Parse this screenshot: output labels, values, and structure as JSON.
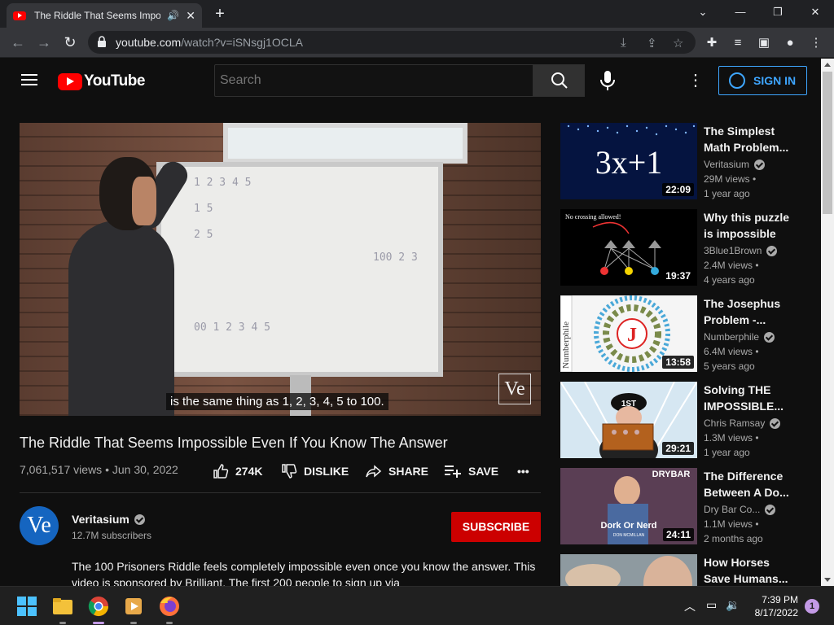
{
  "browser": {
    "tab_title": "The Riddle That Seems Impo",
    "tab_close": "✕",
    "new_tab": "+",
    "url_host": "youtube.com",
    "url_path": "/watch?v=iSNsgj1OCLA",
    "window_controls": [
      "⌄",
      "—",
      "❐",
      "✕"
    ]
  },
  "header": {
    "logo_text": "YouTube",
    "search_placeholder": "Search",
    "sign_in": "SIGN IN"
  },
  "video": {
    "caption": "is the same thing as 1, 2, 3, 4, 5 to 100.",
    "watermark": "Ve",
    "board_lines": [
      "1 2 3 4 5",
      "1 5",
      "2 5",
      "100 2 3",
      "00 1 2 3 4 5"
    ],
    "title": "The Riddle That Seems Impossible Even If You Know The Answer",
    "views": "7,061,517 views",
    "date": "Jun 30, 2022",
    "likes": "274K",
    "dislike": "DISLIKE",
    "share": "SHARE",
    "save": "SAVE",
    "more": "•••"
  },
  "channel": {
    "avatar_text": "Ve",
    "name": "Veritasium",
    "subscribers": "12.7M subscribers",
    "subscribe": "SUBSCRIBE",
    "description": "The 100 Prisoners Riddle feels completely impossible even once you know the answer. This video is sponsored by Brilliant. The first 200 people to sign up via"
  },
  "recommendations": [
    {
      "title": "The Simplest Math Problem...",
      "channel": "Veritasium",
      "verified": true,
      "views": "29M views •",
      "age": "1 year ago",
      "duration": "22:09",
      "thumb_text": "3x+1"
    },
    {
      "title": "Why this puzzle is impossible",
      "channel": "3Blue1Brown",
      "verified": true,
      "views": "2.4M views •",
      "age": "4 years ago",
      "duration": "19:37",
      "thumb_text": "No crossing allowed!"
    },
    {
      "title": "The Josephus Problem -...",
      "channel": "Numberphile",
      "verified": true,
      "views": "6.4M views •",
      "age": "5 years ago",
      "duration": "13:58",
      "thumb_text": "J",
      "thumb_side": "Numberphile"
    },
    {
      "title": "Solving THE IMPOSSIBLE...",
      "channel": "Chris Ramsay",
      "verified": true,
      "views": "1.3M views •",
      "age": "1 year ago",
      "duration": "29:21",
      "thumb_text": "1ST"
    },
    {
      "title": "The Difference Between A Do...",
      "channel": "Dry Bar Co...",
      "verified": true,
      "views": "1.1M views •",
      "age": "2 months ago",
      "duration": "24:11",
      "thumb_text": "Dork Or Nerd",
      "thumb_sub": "DON MCMILLAN",
      "thumb_brand": "DRYBAR"
    },
    {
      "title": "How Horses Save Humans...",
      "channel": "",
      "verified": false,
      "views": "",
      "age": "",
      "duration": "",
      "thumb_text": ""
    }
  ],
  "taskbar": {
    "time": "7:39 PM",
    "date": "8/17/2022",
    "notifications": "1"
  },
  "colors": {
    "bg": "#0f0f0f",
    "accent_red": "#ff0000",
    "subscribe_red": "#cc0000",
    "link_blue": "#3ea6ff"
  }
}
